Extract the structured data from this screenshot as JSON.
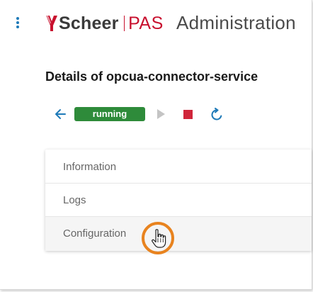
{
  "header": {
    "brand_name": "Scheer",
    "brand_product": "PAS",
    "app_title": "Administration",
    "menu_icon": "more-vertical-icon"
  },
  "page": {
    "title": "Details of opcua-connector-service"
  },
  "toolbar": {
    "back_icon": "arrow-left-icon",
    "status": "running",
    "status_color": "#2e8b3a",
    "play_icon": "play-icon",
    "stop_icon": "stop-icon",
    "refresh_icon": "refresh-icon"
  },
  "panel": {
    "items": [
      {
        "label": "Information"
      },
      {
        "label": "Logs"
      },
      {
        "label": "Configuration"
      }
    ]
  },
  "colors": {
    "accent": "#1f7ab8",
    "brand_red": "#c8102e",
    "cursor_highlight": "#e8831f"
  }
}
